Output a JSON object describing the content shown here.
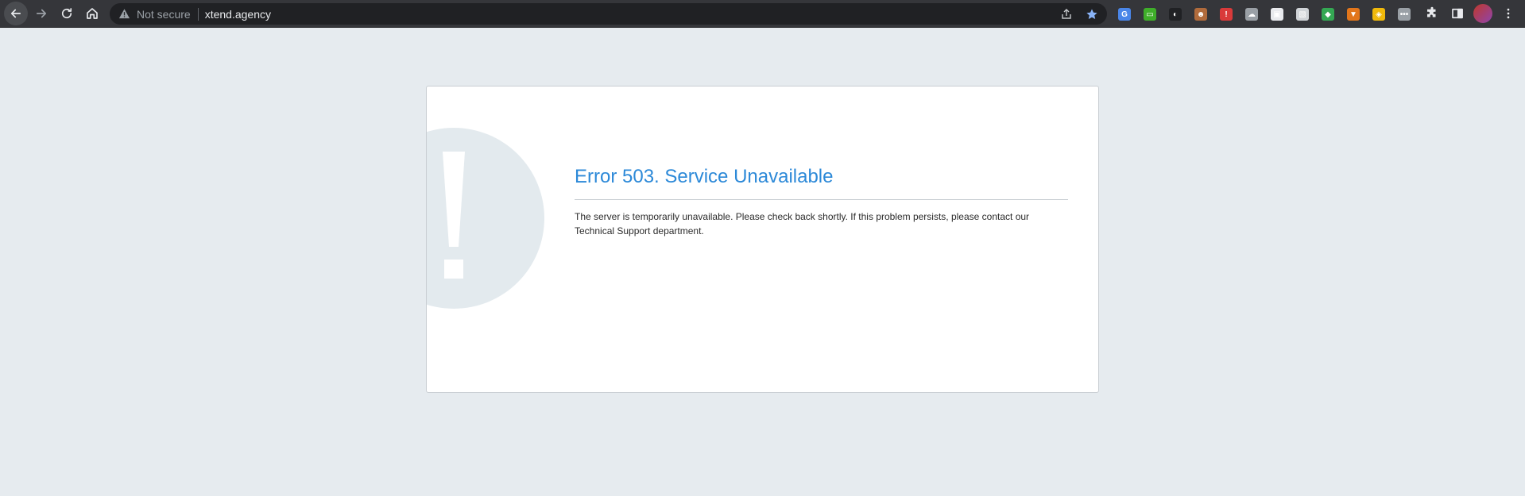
{
  "browser": {
    "nav": {
      "back_icon": "arrow-left-icon",
      "forward_icon": "arrow-right-icon",
      "reload_icon": "reload-icon",
      "home_icon": "home-icon"
    },
    "omnibox": {
      "security_icon": "warning-triangle-icon",
      "security_label": "Not secure",
      "url": "xtend.agency",
      "share_icon": "share-icon",
      "bookmark_icon": "star-icon"
    },
    "extensions": [
      {
        "name": "translate-extension-icon",
        "color": "#4a86e8",
        "glyph": "G"
      },
      {
        "name": "tv-extension-icon",
        "color": "#3fae2a",
        "glyph": "▭"
      },
      {
        "name": "cycle-extension-icon",
        "color": "#202124",
        "glyph": "◐"
      },
      {
        "name": "mascot-extension-icon",
        "color": "#b06b3c",
        "glyph": "☻"
      },
      {
        "name": "red-shield-extension-icon",
        "color": "#d93a3a",
        "glyph": "!"
      },
      {
        "name": "cloud-extension-icon",
        "color": "#9aa0a6",
        "glyph": "☁"
      },
      {
        "name": "robot-extension-icon",
        "color": "#e8eaed",
        "glyph": "▣"
      },
      {
        "name": "image-extension-icon",
        "color": "#d0d4d8",
        "glyph": "▧"
      },
      {
        "name": "green-extension-icon",
        "color": "#34a853",
        "glyph": "◆"
      },
      {
        "name": "fox-extension-icon",
        "color": "#e2761b",
        "glyph": "▼"
      },
      {
        "name": "cube-extension-icon",
        "color": "#f0b90b",
        "glyph": "◈"
      },
      {
        "name": "dots-extension-icon",
        "color": "#9aa0a6",
        "glyph": "•••"
      }
    ],
    "puzzle_icon": "puzzle-icon",
    "sidepanel_icon": "side-panel-icon",
    "profile_icon": "avatar",
    "menu_icon": "kebab-menu-icon"
  },
  "page": {
    "title": "Error 503. Service Unavailable",
    "message": "The server is temporarily unavailable. Please check back shortly. If this problem persists, please contact our Technical Support department.",
    "icon": "exclamation-icon",
    "colors": {
      "title": "#2c89d8",
      "background": "#e6ebef",
      "icon_circle": "#e3eaee"
    }
  }
}
